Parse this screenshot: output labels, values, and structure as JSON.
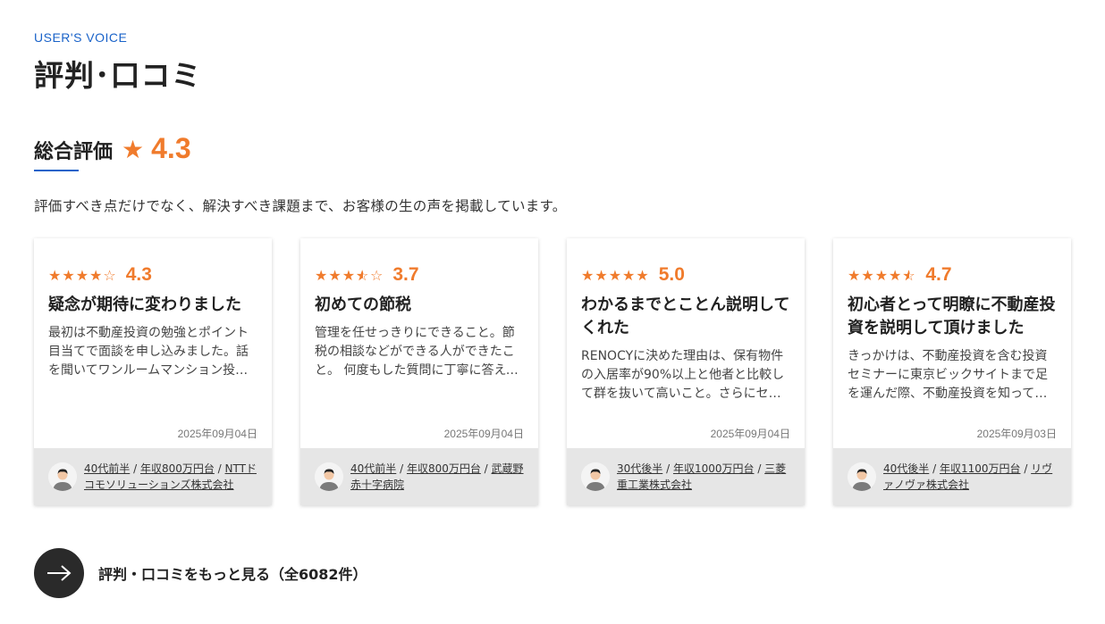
{
  "header": {
    "eyebrow": "USER'S VOICE",
    "title": "評判･口コミ"
  },
  "overall": {
    "label": "総合評価",
    "star": "★",
    "score": "4.3"
  },
  "lead": "評価すべき点だけでなく、解決すべき課題まで、お客様の生の声を掲載しています。",
  "colors": {
    "accent": "#f07b2c",
    "brand": "#1a63c9",
    "footer_bg": "#e6e6e6"
  },
  "reviews": [
    {
      "rating": 4.3,
      "score": "4.3",
      "title": "疑念が期待に変わりました",
      "text": "最初は不動産投資の勉強とポイント目当てで面談を申し込みました。話を聞いてワンルームマンション投資について理解が深まりました。",
      "date": "2025年09月04日",
      "age": "40代前半",
      "income": "年収800万円台",
      "company": "NTTドコモソリューションズ株式会社"
    },
    {
      "rating": 3.7,
      "score": "3.7",
      "title": "初めての節税",
      "text": "管理を任せっきりにできること。節税の相談などができる人ができたこと。 何度もした質問に丁寧に答えていただきました。",
      "date": "2025年09月04日",
      "age": "40代前半",
      "income": "年収800万円台",
      "company": "武蔵野赤十字病院"
    },
    {
      "rating": 5.0,
      "score": "5.0",
      "title": "わかるまでとことん説明してくれた",
      "text": "RENOCYに決めた理由は、保有物件の入居率が90%以上と他者と比較して群を抜いて高いこと。さらにセミナーの内容が丁寧だったことです。",
      "date": "2025年09月04日",
      "age": "30代後半",
      "income": "年収1000万円台",
      "company": "三菱重工業株式会社"
    },
    {
      "rating": 4.7,
      "score": "4.7",
      "title": "初心者とって明瞭に不動産投資を説明して頂けました",
      "text": "きっかけは、不動産投資を含む投資セミナーに東京ビックサイトまで足を運んだ際、不動産投資を知ってから興味を持ちました。",
      "date": "2025年09月03日",
      "age": "40代後半",
      "income": "年収1100万円台",
      "company": "リヴァノヴァ株式会社"
    }
  ],
  "more": {
    "icon": "arrow-right-icon",
    "label": "評判・口コミをもっと見る（全6082件）"
  }
}
